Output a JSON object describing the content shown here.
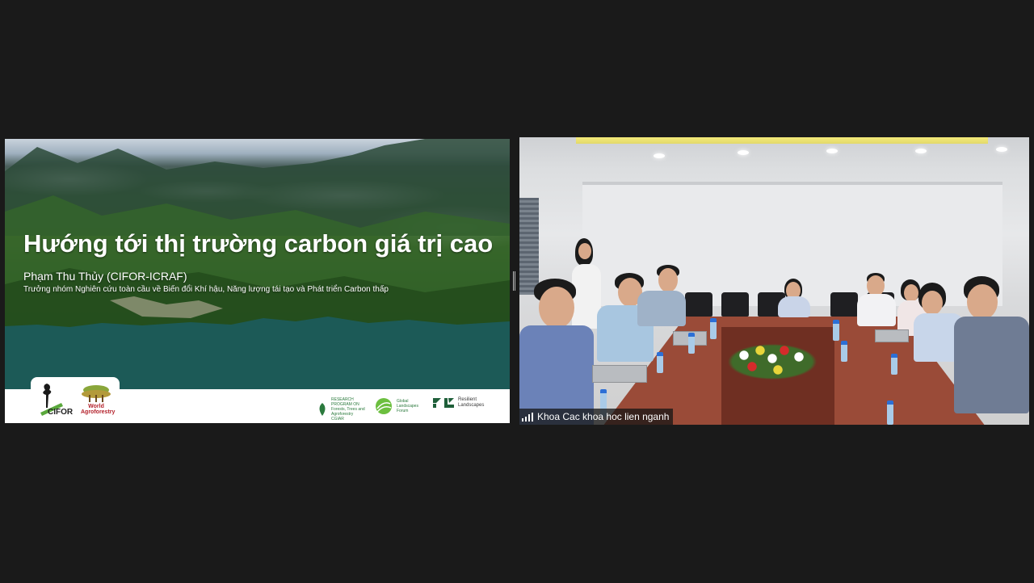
{
  "slide": {
    "title": "Hướng tới thị trường carbon giá trị cao",
    "author": "Phạm Thu Thủy (CIFOR-ICRAF)",
    "role": "Trưởng nhóm Nghiên cứu toàn cầu về Biến đổi Khí hậu, Năng lượng tái tạo và Phát triển Carbon thấp",
    "logos": {
      "cifor": "CIFOR",
      "world_agroforestry": "World Agroforestry",
      "cgiar": "RESEARCH PROGRAM ON Forests, Trees and Agroforestry",
      "cgiar_short": "CGIAR",
      "glf": "Global Landscapes Forum",
      "rl": "Resilient Landscapes"
    }
  },
  "video": {
    "participant_name": "Khoa Cac khoa hoc lien nganh",
    "signal_icon": "signal-bars-icon"
  }
}
